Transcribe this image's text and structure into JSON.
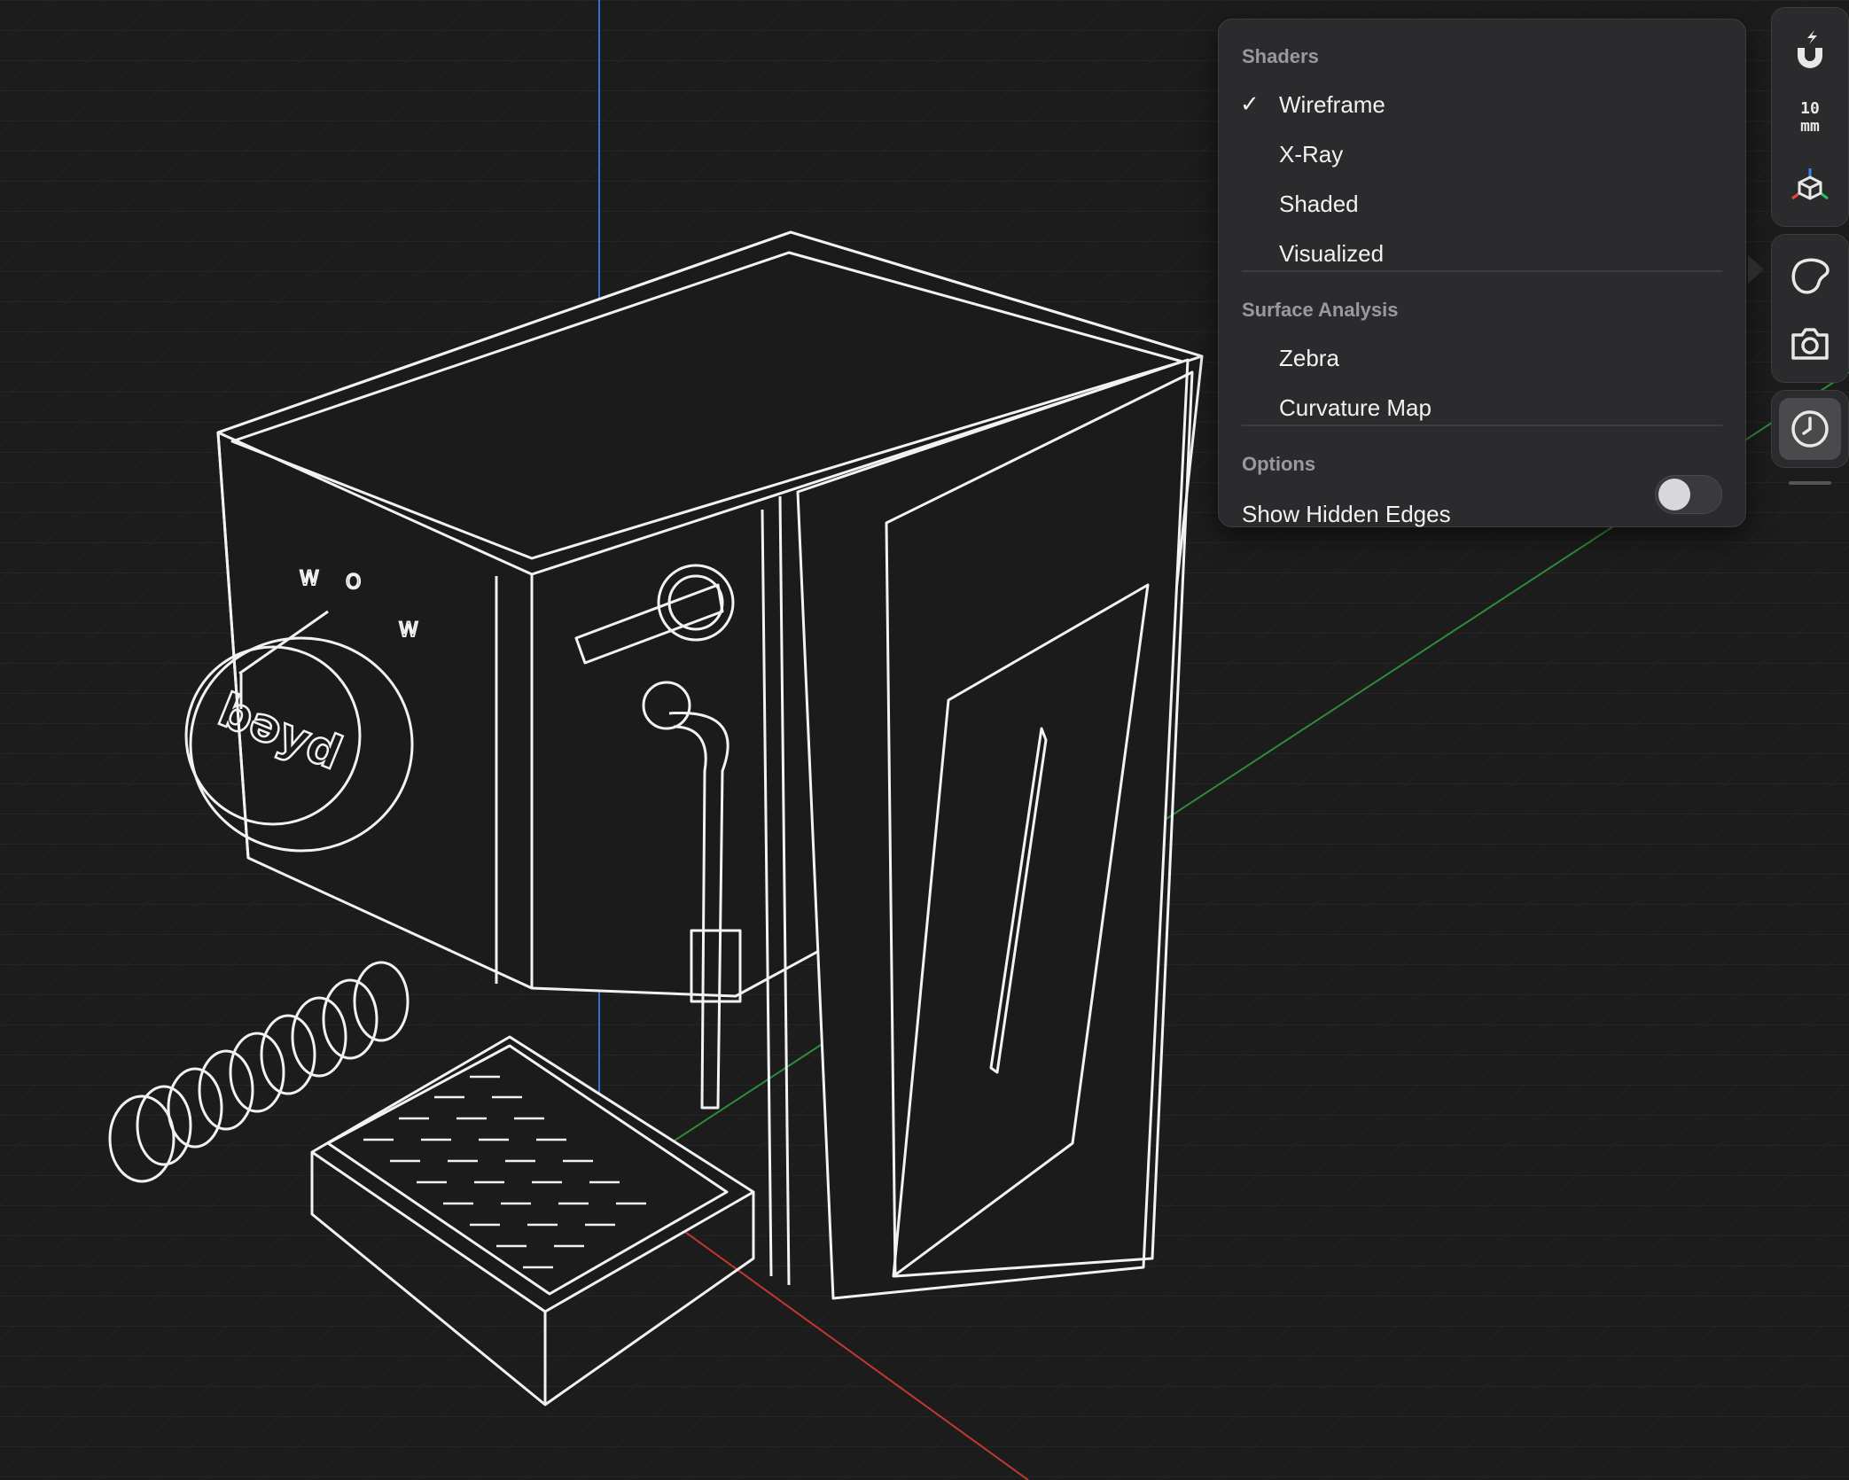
{
  "menu": {
    "shaders_title": "Shaders",
    "shaders": [
      {
        "label": "Wireframe",
        "checked": true
      },
      {
        "label": "X-Ray",
        "checked": false
      },
      {
        "label": "Shaded",
        "checked": false
      },
      {
        "label": "Visualized",
        "checked": false
      }
    ],
    "check_glyph": "✓",
    "surface_title": "Surface Analysis",
    "surface": [
      {
        "label": "Zebra"
      },
      {
        "label": "Curvature Map"
      }
    ],
    "options_title": "Options",
    "show_hidden_edges_label": "Show Hidden Edges",
    "show_hidden_edges_on": false
  },
  "toolbar": {
    "snap_value": "10",
    "snap_unit": "mm",
    "icons": [
      "magnet-icon",
      "axis-cube-icon",
      "shader-blob-icon",
      "camera-icon",
      "clock-icon"
    ]
  },
  "model": {
    "brand_label": "bəyd",
    "dial_marks": [
      "W",
      "O",
      "W"
    ]
  },
  "colors": {
    "background": "#1c1c1c",
    "grid": "#2a2a2a",
    "axis_x": "#c0392b",
    "axis_y": "#2e8b3a",
    "axis_z": "#2f6fd6",
    "wire": "#f5f5f5",
    "panel": "#2b2b2d"
  }
}
